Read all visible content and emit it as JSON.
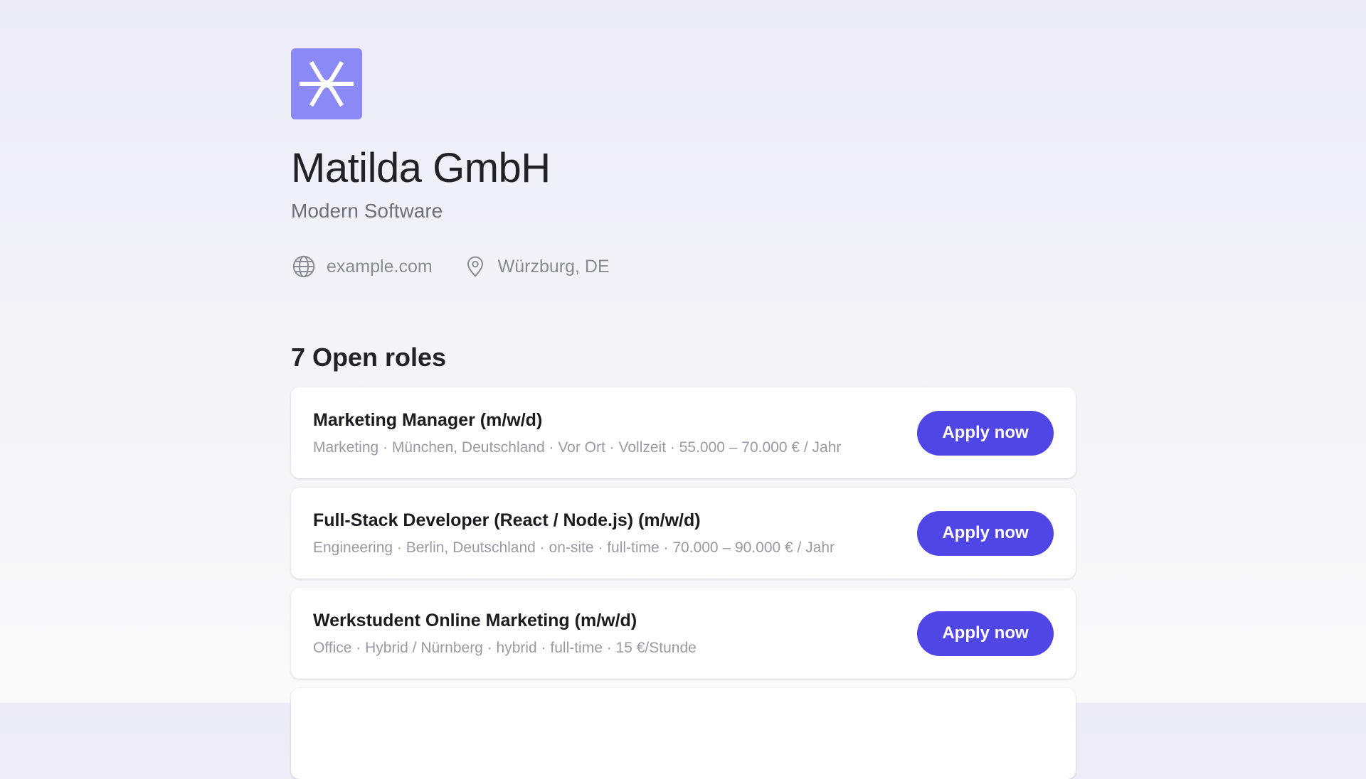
{
  "company": {
    "name": "Matilda GmbH",
    "tagline": "Modern Software",
    "logo_color": "#8b89f5",
    "logo_icon": "asterisk-cross-icon",
    "website": "example.com",
    "location": "Würzburg, DE"
  },
  "roles": {
    "heading": "7 Open roles",
    "apply_label": "Apply now",
    "accent": "#4f46e5",
    "items": [
      {
        "title": "Marketing Manager (m/w/d)",
        "meta": "Marketing · München, Deutschland · Vor Ort · Vollzeit · 55.000 – 70.000 € / Jahr",
        "button": "Apply now"
      },
      {
        "title": "Full-Stack Developer (React / Node.js) (m/w/d)",
        "meta": "Engineering · Berlin, Deutschland · on-site · full-time · 70.000 – 90.000 € / Jahr",
        "button": "Apply now"
      },
      {
        "title": "Werkstudent Online Marketing (m/w/d)",
        "meta": "Office · Hybrid / Nürnberg · hybrid · full-time · 15 €/Stunde",
        "button": "Apply now"
      },
      {
        "title": "",
        "meta": "",
        "button": ""
      }
    ]
  }
}
